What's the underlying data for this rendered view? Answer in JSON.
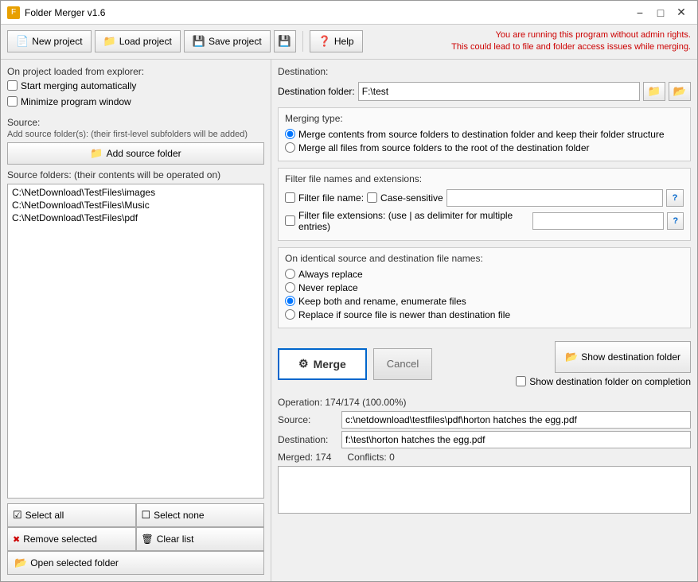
{
  "window": {
    "title": "Folder Merger v1.6",
    "minimize_label": "−",
    "maximize_label": "□",
    "close_label": "✕"
  },
  "toolbar": {
    "new_project": "New project",
    "load_project": "Load project",
    "save_project": "Save project",
    "help": "Help",
    "admin_warning_line1": "You are running this program without admin rights.",
    "admin_warning_line2": "This could lead to file and folder access issues while merging."
  },
  "left": {
    "on_project_label": "On project loaded from explorer:",
    "start_merging_label": "Start merging automatically",
    "minimize_label": "Minimize program window",
    "source_label": "Source:",
    "add_source_sublabel": "Add source folder(s): (their first-level subfolders will be added)",
    "add_source_btn": "Add source folder",
    "folders_label": "Source folders: (their contents will be operated on)",
    "folders": [
      "C:\\NetDownload\\TestFiles\\images",
      "C:\\NetDownload\\TestFiles\\Music",
      "C:\\NetDownload\\TestFiles\\pdf"
    ],
    "select_all": "Select all",
    "select_none": "Select none",
    "remove_selected": "Remove selected",
    "clear_list": "Clear list",
    "open_selected": "Open selected folder"
  },
  "right": {
    "destination_label": "Destination:",
    "destination_folder_label": "Destination folder:",
    "destination_folder_value": "F:\\test",
    "merging_type_label": "Merging type:",
    "merge_option1": "Merge contents from source folders to destination folder and keep their folder structure",
    "merge_option2": "Merge all files from source folders to the root of the destination folder",
    "filter_label": "Filter file names and extensions:",
    "filter_name_label": "Filter file name:",
    "case_sensitive_label": "Case-sensitive",
    "filter_ext_label": "Filter file extensions: (use | as delimiter for multiple entries)",
    "identical_label": "On identical source and destination file names:",
    "always_replace": "Always replace",
    "never_replace": "Never replace",
    "keep_both": "Keep both and rename, enumerate files",
    "replace_newer": "Replace if source file is newer than destination file",
    "merge_btn": "Merge",
    "cancel_btn": "Cancel",
    "show_dest_btn": "Show destination folder",
    "show_dest_check": "Show destination folder on completion",
    "operation_text": "Operation: 174/174 (100.00%)",
    "source_label": "Source:",
    "source_value": "c:\\netdownload\\testfiles\\pdf\\horton hatches the egg.pdf",
    "dest_label": "Destination:",
    "dest_value": "f:\\test\\horton hatches the egg.pdf",
    "merged_label": "Merged:",
    "merged_value": "174",
    "conflicts_label": "Conflicts:",
    "conflicts_value": "0"
  }
}
